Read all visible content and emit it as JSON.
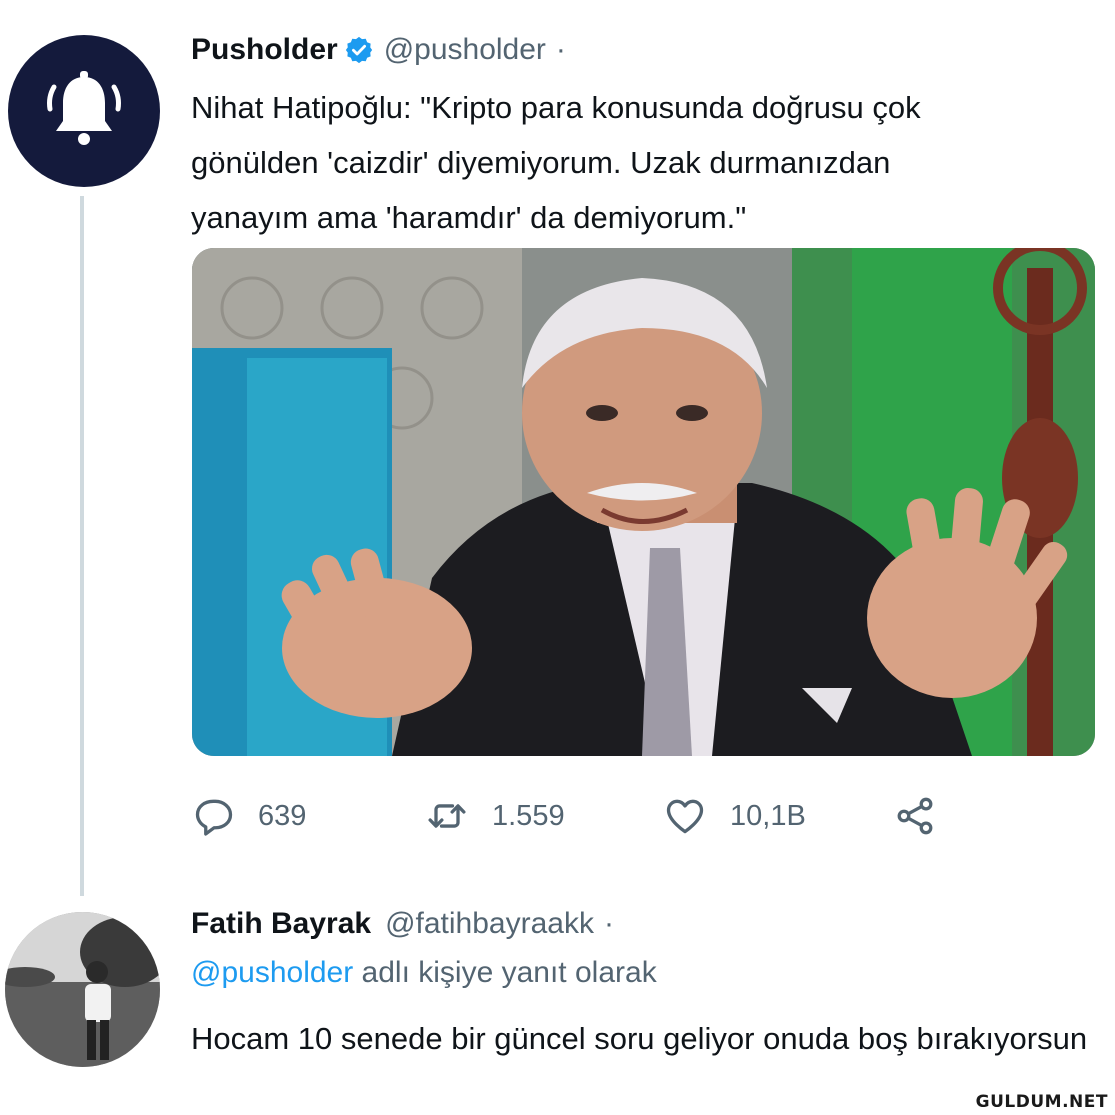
{
  "tweet": {
    "author": {
      "display_name": "Pusholder",
      "handle": "@pusholder",
      "separator": "·",
      "avatar_icon": "bell-icon",
      "verified_icon": "verified-badge-icon"
    },
    "text": "Nihat Hatipoğlu: \"Kripto para konusunda doğrusu çok\ngönülden 'caizdir' diyemiyorum. Uzak durmanızdan\nyanayım ama 'haramdır' da demiyorum.\"",
    "actions": {
      "reply_count": "639",
      "retweet_count": "1.559",
      "like_count": "10,1B"
    }
  },
  "reply": {
    "author": {
      "display_name": "Fatih Bayrak",
      "handle": "@fatihbayraakk",
      "separator": "·"
    },
    "replying_to_mention": "@pusholder",
    "replying_to_suffix": " adlı kişiye yanıt olarak",
    "text": "Hocam 10 senede bir güncel soru geliyor onuda boş bırakıyorsun"
  },
  "watermark": "GULDUM.NET",
  "colors": {
    "text_primary": "#0f1419",
    "text_secondary": "#536471",
    "link_blue": "#1d9bf0",
    "verified_blue": "#1d9bf0",
    "avatar_navy": "#141a3c",
    "thread_line": "#cfd9de"
  }
}
